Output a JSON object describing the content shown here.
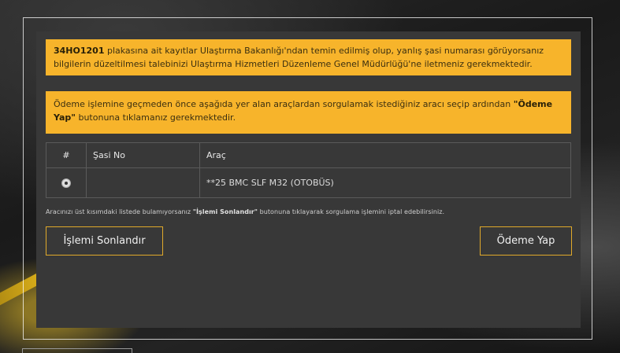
{
  "notice1": {
    "plate": "34HO1201",
    "text": " plakasına ait kayıtlar Ulaştırma Bakanlığı'ndan temin edilmiş olup, yanlış şasi numarası görüyorsanız bilgilerin düzeltilmesi talebinizi Ulaştırma Hizmetleri Düzenleme Genel Müdürlüğü'ne iletmeniz gerekmektedir."
  },
  "notice2": {
    "text_before": "Ödeme işlemine geçmeden önce aşağıda yer alan araçlardan sorgulamak istediğiniz aracı seçip ardından ",
    "highlight": "\"Ödeme Yap\"",
    "text_after": " butonuna tıklamanız gerekmektedir."
  },
  "table": {
    "headers": [
      "#",
      "Şasi No",
      "Araç"
    ],
    "rows": [
      {
        "chassis": "",
        "vehicle": "**25 BMC SLF M32 (OTOBÜS)"
      }
    ]
  },
  "hint": {
    "before": "Aracınızı üst kısımdaki listede bulamıyorsanız ",
    "highlight": "\"İşlemi Sonlandır\"",
    "after": " butonuna tıklayarak sorgulama işlemini iptal edebilirsiniz."
  },
  "buttons": {
    "end": "İşlemi Sonlandır",
    "pay": "Ödeme Yap"
  },
  "colors": {
    "accent": "#f7b42b",
    "panel": "#383838"
  }
}
